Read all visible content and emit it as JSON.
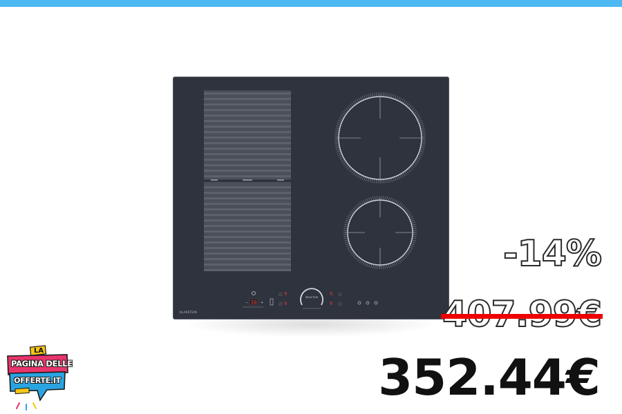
{
  "colors": {
    "top_bar": "#4db8f2",
    "hob_glass": "#2e333d",
    "zone_ring": "#c8ccd2",
    "display_red": "#e23b3b",
    "strike": "#ee0000",
    "price_text": "#111111",
    "logo_pink": "#e8356b",
    "logo_blue": "#2aa4e0",
    "logo_yellow": "#f5c518"
  },
  "product": {
    "image_alt": "Induction hob",
    "brand": "KLARSTEIN",
    "control_display": "30",
    "slider_label": "INDUCTION"
  },
  "pricing": {
    "discount": "-14%",
    "old_price": "407.99€",
    "new_price": "352.44€"
  },
  "logo": {
    "line_top": "LA",
    "line_1": "PAGINA DELLE",
    "line_2": "OFFERTE.IT"
  }
}
